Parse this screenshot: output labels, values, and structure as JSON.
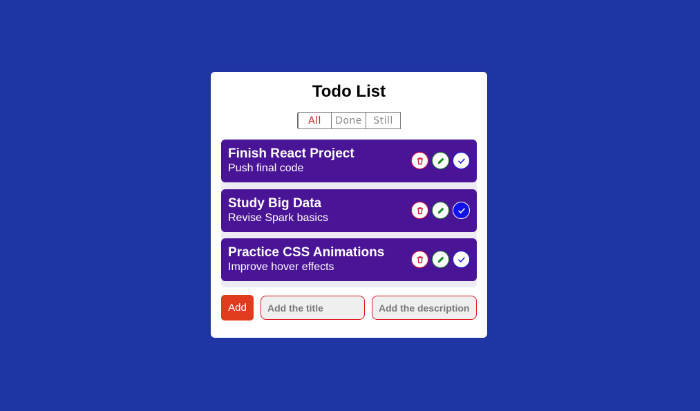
{
  "app": {
    "title": "Todo List"
  },
  "filters": [
    {
      "label": "All",
      "active": true
    },
    {
      "label": "Done",
      "active": false
    },
    {
      "label": "Still",
      "active": false
    }
  ],
  "todos": [
    {
      "title": "Finish React Project",
      "description": "Push final code",
      "done": false
    },
    {
      "title": "Study Big Data",
      "description": "Revise Spark basics",
      "done": true
    },
    {
      "title": "Practice CSS Animations",
      "description": "Improve hover effects",
      "done": false
    }
  ],
  "form": {
    "add_label": "Add",
    "title_placeholder": "Add the title",
    "description_placeholder": "Add the description",
    "title_value": "",
    "description_value": ""
  },
  "colors": {
    "background": "#2035a4",
    "item_background": "#4a1496",
    "add_button": "#e03b1e",
    "active_filter": "#e01b1b",
    "delete": "#e0143c",
    "edit": "#1b8a2a",
    "done": "#1a1ae0"
  },
  "icons": {
    "delete": "trash-icon",
    "edit": "pencil-icon",
    "done": "check-icon"
  }
}
